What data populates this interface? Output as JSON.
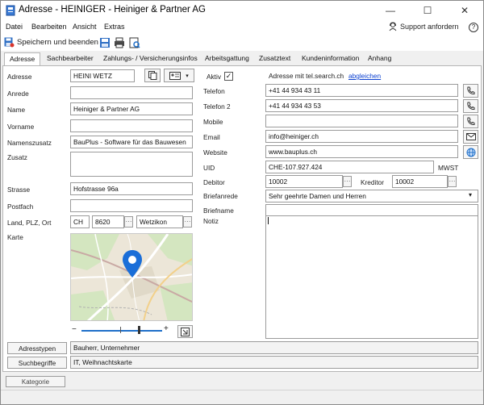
{
  "window": {
    "title": "Adresse - HEINIGER - Heiniger & Partner AG",
    "minimize_glyph": "—",
    "maximize_glyph": "☐",
    "close_glyph": "✕"
  },
  "menu": {
    "items": [
      "Datei",
      "Bearbeiten",
      "Ansicht",
      "Extras"
    ],
    "support_label": "Support anfordern",
    "help_glyph": "?"
  },
  "toolbar": {
    "save_close_label": "Speichern und beenden"
  },
  "tabs": [
    {
      "label": "Adresse",
      "active": true
    },
    {
      "label": "Sachbearbeiter"
    },
    {
      "label": "Zahlungs- / Versicherungsinfos"
    },
    {
      "label": "Arbeitsgattung"
    },
    {
      "label": "Zusatztext"
    },
    {
      "label": "Kundeninformation"
    },
    {
      "label": "Anhang"
    }
  ],
  "left": {
    "adresse_label": "Adresse",
    "adresse_value": "HEINI WETZ",
    "anrede_label": "Anrede",
    "anrede_value": "",
    "name_label": "Name",
    "name_value": "Heiniger & Partner AG",
    "vorname_label": "Vorname",
    "vorname_value": "",
    "namenszusatz_label": "Namenszusatz",
    "namenszusatz_value": "BauPlus - Software für das Bauwesen",
    "zusatz_label": "Zusatz",
    "zusatz_value": "",
    "strasse_label": "Strasse",
    "strasse_value": "Hofstrasse 96a",
    "postfach_label": "Postfach",
    "postfach_value": "",
    "ort_label": "Land, PLZ, Ort",
    "land_value": "CH",
    "plz_value": "8620",
    "ort_value": "Wetzikon",
    "karte_label": "Karte",
    "zoom_minus": "−",
    "zoom_plus": "+",
    "zoom_level": 0.85
  },
  "right": {
    "aktiv_label": "Aktiv",
    "aktiv_checked": true,
    "tel_search_label": "Adresse mit tel.search.ch",
    "abgleichen_link": "abgleichen",
    "telefon_label": "Telefon",
    "telefon_value": "+41 44 934 43 11",
    "telefon2_label": "Telefon 2",
    "telefon2_value": "+41 44 934 43 53",
    "mobile_label": "Mobile",
    "mobile_value": "",
    "email_label": "Email",
    "email_value": "info@heiniger.ch",
    "website_label": "Website",
    "website_value": "www.bauplus.ch",
    "uid_label": "UID",
    "uid_value": "CHE-107.927.424",
    "mwst_label": "MWST",
    "debitor_label": "Debitor",
    "debitor_value": "10002",
    "kreditor_label": "Kreditor",
    "kreditor_value": "10002",
    "briefanrede_label": "Briefanrede",
    "briefanrede_value": "Sehr geehrte Damen und Herren",
    "briefname_label": "Briefname",
    "briefname_value": "",
    "notiz_label": "Notiz",
    "notiz_value": ""
  },
  "bottom": {
    "adresstypen_button": "Adresstypen",
    "adresstypen_value": "Bauherr, Unternehmer",
    "suchbegriffe_button": "Suchbegriffe",
    "suchbegriffe_value": "IT, Weihnachtskarte"
  },
  "status": {
    "kategorie_label": "Kategorie"
  },
  "colors": {
    "accent": "#1f6fc9",
    "pin": "#1a6ed8",
    "link": "#0a3fd0",
    "map_land": "#e9e3d6",
    "map_green": "#cfe4bb"
  }
}
